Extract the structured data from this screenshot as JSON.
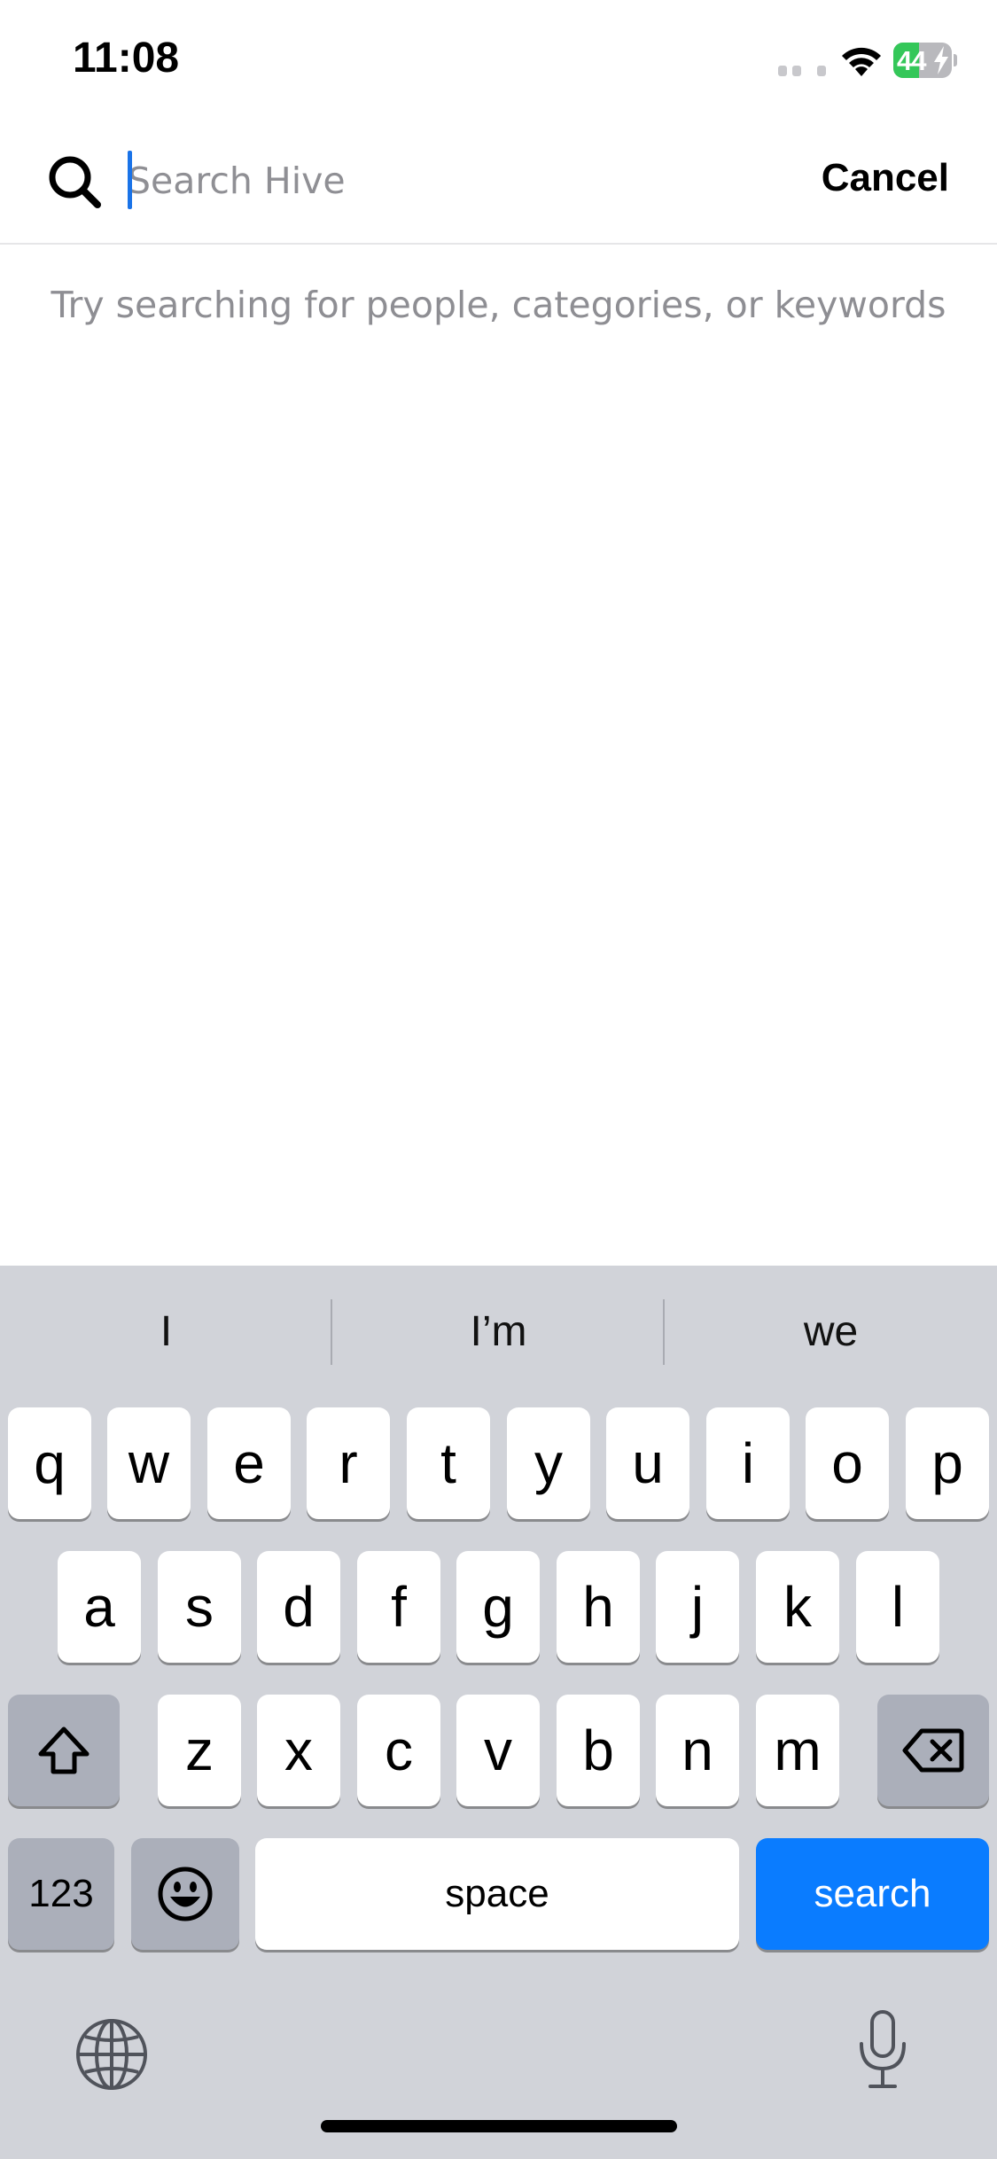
{
  "status_bar": {
    "time": "11:08",
    "battery_level": "44",
    "battery_percent": 44,
    "battery_color": "#34c759",
    "icons": [
      "signal-icon",
      "wifi-icon",
      "battery-icon",
      "charging-bolt-icon"
    ]
  },
  "search": {
    "placeholder": "Search Hive",
    "value": "",
    "cancel_label": "Cancel",
    "caret_color": "#1a73e8"
  },
  "hint": "Try searching for people, categories, or keywords",
  "keyboard": {
    "suggestions": [
      "I",
      "I’m",
      "we"
    ],
    "row1": [
      "q",
      "w",
      "e",
      "r",
      "t",
      "y",
      "u",
      "i",
      "o",
      "p"
    ],
    "row2": [
      "a",
      "s",
      "d",
      "f",
      "g",
      "h",
      "j",
      "k",
      "l"
    ],
    "row3": [
      "z",
      "x",
      "c",
      "v",
      "b",
      "n",
      "m"
    ],
    "numbers_label": "123",
    "space_label": "space",
    "action_label": "search",
    "action_color": "#0a7cff",
    "icons": [
      "shift-icon",
      "backspace-icon",
      "emoji-icon",
      "globe-icon",
      "microphone-icon"
    ]
  }
}
